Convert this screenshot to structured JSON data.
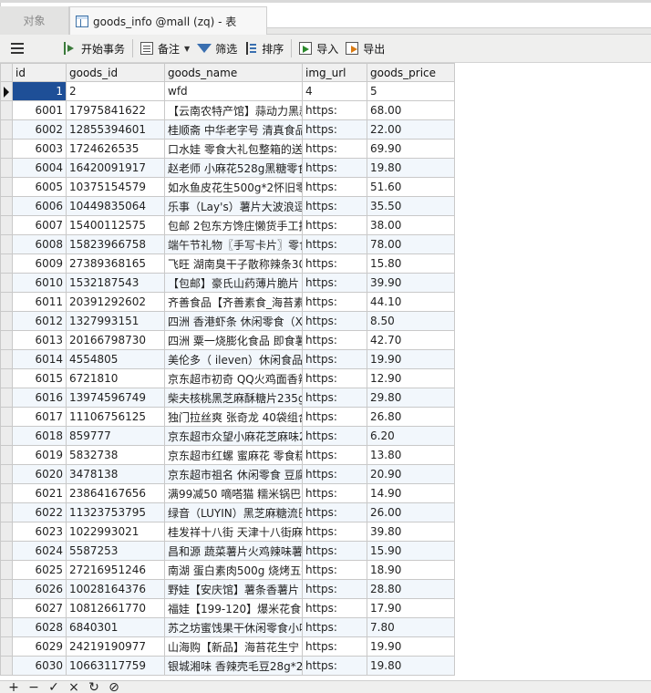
{
  "tabs": {
    "objects_label": "对象",
    "active_label": "goods_info @mall (zq) - 表"
  },
  "toolbar": {
    "begin_tx": "开始事务",
    "memo": "备注",
    "filter": "筛选",
    "sort": "排序",
    "import": "导入",
    "export": "导出"
  },
  "grid": {
    "columns": [
      "id",
      "goods_id",
      "goods_name",
      "img_url",
      "goods_price"
    ],
    "rows": [
      [
        "1",
        "2",
        "wfd",
        "4",
        "5"
      ],
      [
        "6001",
        "17975841622",
        "【云南农特产馆】蒜动力黑蒜",
        "https:",
        "68.00"
      ],
      [
        "6002",
        "12855394601",
        "桂顺斋 中华老字号 清真食品",
        "https:",
        "22.00"
      ],
      [
        "6003",
        "1724626535",
        "口水娃 零食大礼包整箱的送",
        "https:",
        "69.90"
      ],
      [
        "6004",
        "16420091917",
        "赵老师 小麻花528g黑糖零食",
        "https:",
        "19.80"
      ],
      [
        "6005",
        "10375154579",
        "如水鱼皮花生500g*2怀旧零",
        "https:",
        "51.60"
      ],
      [
        "6006",
        "10449835064",
        "乐事（Lay's）薯片大波浪逗",
        "https:",
        "35.50"
      ],
      [
        "6007",
        "15400112575",
        "包邮 2包东方馋庄懒货手工推",
        "https:",
        "38.00"
      ],
      [
        "6008",
        "15823966758",
        "端午节礼物〖手写卡片〗零食",
        "https:",
        "78.00"
      ],
      [
        "6009",
        "27389368165",
        "飞旺 湖南臭干子散称辣条30",
        "https:",
        "15.80"
      ],
      [
        "6010",
        "1532187543",
        "【包邮】豪氏山药薄片脆片",
        "https:",
        "39.90"
      ],
      [
        "6011",
        "20391292602",
        "齐善食品【齐善素食_海苔素",
        "https:",
        "44.10"
      ],
      [
        "6012",
        "1327993151",
        "四洲 香港虾条 休闲零食（X",
        "https:",
        "8.50"
      ],
      [
        "6013",
        "20166798730",
        "四洲 粟一烧膨化食品 即食薯",
        "https:",
        "42.70"
      ],
      [
        "6014",
        "4554805",
        "美伦多（ ileven）休闲食品",
        "https:",
        "19.90"
      ],
      [
        "6015",
        "6721810",
        "京东超市初奇 QQ火鸡面香辣",
        "https:",
        "12.90"
      ],
      [
        "6016",
        "13974596749",
        "柴夫核桃黑芝麻酥糖片235g",
        "https:",
        "29.80"
      ],
      [
        "6017",
        "11106756125",
        "独门拉丝爽 张奇龙 40袋组合",
        "https:",
        "26.80"
      ],
      [
        "6018",
        "859777",
        "京东超市众望小麻花芝麻味2",
        "https:",
        "6.20"
      ],
      [
        "6019",
        "5832738",
        "京东超市红螺 蜜麻花 零食糕",
        "https:",
        "13.80"
      ],
      [
        "6020",
        "3478138",
        "京东超市祖名 休闲零食 豆腐",
        "https:",
        "20.90"
      ],
      [
        "6021",
        "23864167656",
        "满99减50 嘀嗒猫 糯米锅巴2",
        "https:",
        "14.90"
      ],
      [
        "6022",
        "11323753795",
        "绿音（LUYIN）黑芝麻糖流巴",
        "https:",
        "26.00"
      ],
      [
        "6023",
        "1022993021",
        "桂发祥十八街 天津十八街麻",
        "https:",
        "39.80"
      ],
      [
        "6024",
        "5587253",
        "昌和源 蔬菜薯片火鸡辣味薯",
        "https:",
        "15.90"
      ],
      [
        "6025",
        "27216951246",
        "南湖 蛋白素肉500g 烧烤五香",
        "https:",
        "18.90"
      ],
      [
        "6026",
        "10028164376",
        "野娃【安庆馆】薯条香薯片",
        "https:",
        "28.80"
      ],
      [
        "6027",
        "10812661770",
        "福娃【199-120】爆米花食品",
        "https:",
        "17.90"
      ],
      [
        "6028",
        "6840301",
        "苏之坊蜜饯果干休闲零食小吗",
        "https:",
        "7.80"
      ],
      [
        "6029",
        "24219190977",
        "山海购【新品】海苔花生宁",
        "https:",
        "19.90"
      ],
      [
        "6030",
        "10663117759",
        "银城湘味 香辣壳毛豆28g*20",
        "https:",
        "19.80"
      ]
    ]
  },
  "bottom": {
    "add": "+",
    "remove": "−",
    "check": "✓",
    "cancel": "×",
    "refresh": "↻",
    "stop": "⊘"
  },
  "colors": {
    "selected_cell": "#1e4f97",
    "alt_row": "#f2f7fc",
    "filter_icon": "#3a6fb0"
  }
}
